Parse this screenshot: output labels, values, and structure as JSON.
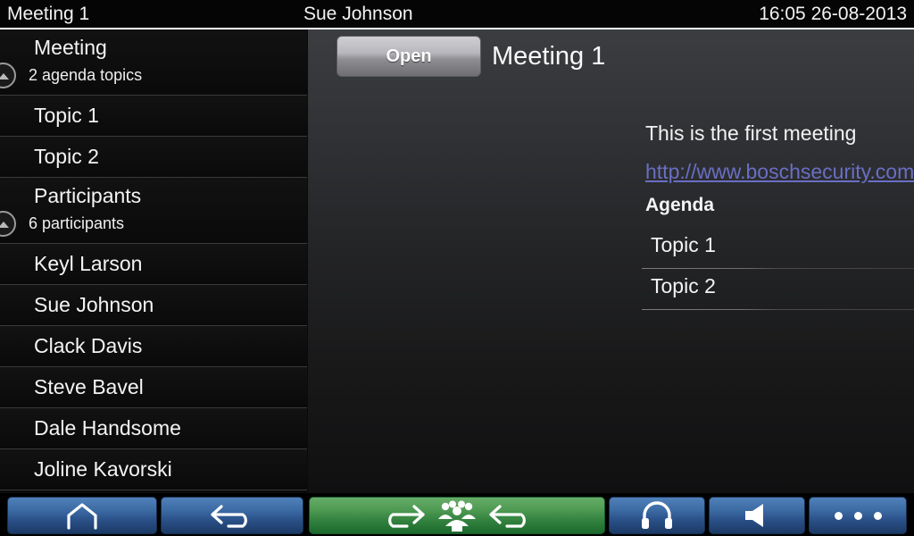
{
  "topbar": {
    "meeting_title": "Meeting 1",
    "current_user": "Sue Johnson",
    "clock": "16:05 26-08-2013"
  },
  "sidebar": {
    "sections": [
      {
        "type": "header",
        "name": "meeting",
        "title": "Meeting",
        "subtitle": "2 agenda topics",
        "collapse_icon": "collapse-up-icon"
      },
      {
        "type": "item",
        "name": "topic-1",
        "label": "Topic 1"
      },
      {
        "type": "item",
        "name": "topic-2",
        "label": "Topic 2"
      },
      {
        "type": "header",
        "name": "participants",
        "title": "Participants",
        "subtitle": "6 participants",
        "collapse_icon": "collapse-up-icon"
      },
      {
        "type": "item",
        "name": "participant-keyl-larson",
        "label": "Keyl Larson"
      },
      {
        "type": "item",
        "name": "participant-sue-johnson",
        "label": "Sue Johnson"
      },
      {
        "type": "item",
        "name": "participant-clack-davis",
        "label": "Clack Davis"
      },
      {
        "type": "item",
        "name": "participant-steve-bavel",
        "label": "Steve Bavel"
      },
      {
        "type": "item",
        "name": "participant-dale-handsome",
        "label": "Dale Handsome"
      },
      {
        "type": "item",
        "name": "participant-joline-kavorski",
        "label": "Joline Kavorski"
      }
    ]
  },
  "content": {
    "open_button_label": "Open",
    "meeting_title": "Meeting 1",
    "description": "This is the first meeting",
    "link_text": "http://www.boschsecurity.com/",
    "link_color": "#6a6ec4",
    "agenda_heading": "Agenda",
    "agenda_items": [
      {
        "name": "agenda-topic-1",
        "label": "Topic 1"
      },
      {
        "name": "agenda-topic-2",
        "label": "Topic 2"
      }
    ]
  },
  "bottombar": {
    "accent_blue": "#3c6ba4",
    "accent_green": "#4e9a53",
    "buttons": [
      {
        "name": "home-button",
        "icon": "home-icon",
        "style": "blue"
      },
      {
        "name": "back-button",
        "icon": "back-arrow-icon",
        "style": "blue"
      },
      {
        "name": "discussion-button",
        "icons": [
          "forward-arrow-icon",
          "group-people-icon",
          "back-arrow-icon"
        ],
        "style": "green"
      },
      {
        "name": "headphones-button",
        "icon": "headphones-icon",
        "style": "blue"
      },
      {
        "name": "volume-button",
        "icon": "speaker-icon",
        "style": "blue"
      },
      {
        "name": "more-button",
        "icon": "three-dots-icon",
        "style": "blue"
      }
    ]
  }
}
